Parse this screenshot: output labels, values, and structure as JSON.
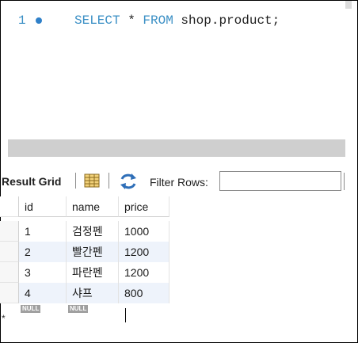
{
  "editor": {
    "line_number": "1",
    "code": {
      "kw1": "SELECT",
      "mid": " * ",
      "kw2": "FROM",
      "rest": " shop.product;"
    }
  },
  "toolbar": {
    "result_grid_label": "Result Grid",
    "filter_label": "Filter Rows:",
    "filter_value": ""
  },
  "grid": {
    "columns": [
      "id",
      "name",
      "price"
    ],
    "rows": [
      [
        "1",
        "검정펜",
        "1000"
      ],
      [
        "2",
        "빨간펜",
        "1200"
      ],
      [
        "3",
        "파란펜",
        "1200"
      ],
      [
        "4",
        "샤프",
        "800"
      ]
    ],
    "new_row_marker": "*",
    "null_label": "NULL"
  },
  "colors": {
    "keyword": "#3a8fc5",
    "alt_row": "#eef3fb",
    "scrollbar": "#cfcfcf"
  }
}
